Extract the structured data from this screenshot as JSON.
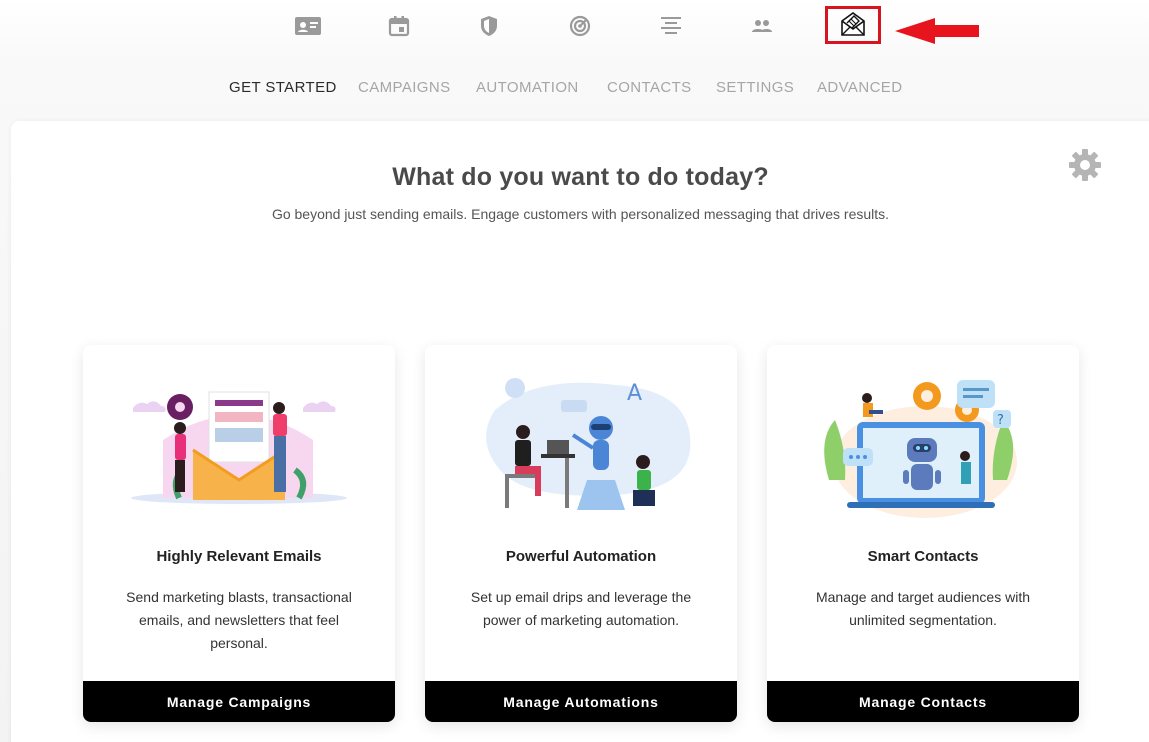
{
  "top_icons": [
    {
      "name": "contact-card-icon"
    },
    {
      "name": "calendar-icon"
    },
    {
      "name": "shield-icon"
    },
    {
      "name": "radar-icon"
    },
    {
      "name": "align-center-icon"
    },
    {
      "name": "people-icon"
    },
    {
      "name": "mail-icon",
      "highlighted": true
    }
  ],
  "annotation": {
    "highlight_color": "#d8151f",
    "arrow_color": "#e8141d"
  },
  "tabs": [
    {
      "label": "GET STARTED",
      "active": true
    },
    {
      "label": "CAMPAIGNS",
      "active": false
    },
    {
      "label": "AUTOMATION",
      "active": false
    },
    {
      "label": "CONTACTS",
      "active": false
    },
    {
      "label": "SETTINGS",
      "active": false
    },
    {
      "label": "ADVANCED",
      "active": false
    }
  ],
  "main": {
    "headline": "What do you want to do today?",
    "subline": "Go beyond just sending emails. Engage customers with personalized messaging that drives results."
  },
  "features": [
    {
      "title": "Highly Relevant Emails",
      "description": "Send marketing blasts, transactional emails, and newsletters that feel personal.",
      "button": "Manage Campaigns"
    },
    {
      "title": "Powerful Automation",
      "description": "Set up email drips and leverage the power of marketing automation.",
      "button": "Manage Automations"
    },
    {
      "title": "Smart Contacts",
      "description": "Manage and target audiences with unlimited segmentation.",
      "button": "Manage Contacts"
    }
  ]
}
